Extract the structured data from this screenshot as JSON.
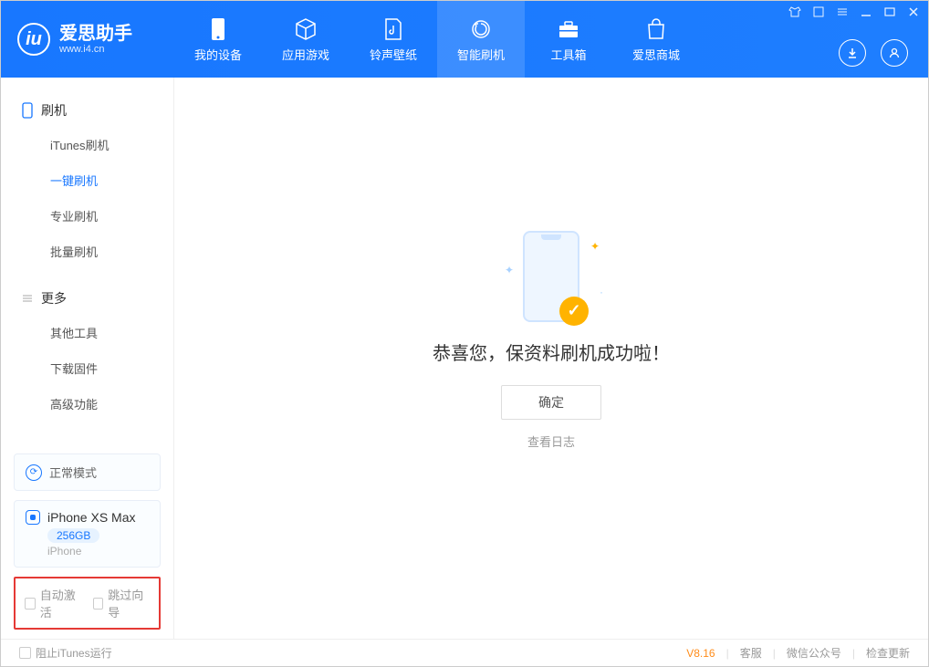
{
  "app": {
    "title": "爱思助手",
    "subtitle": "www.i4.cn"
  },
  "nav": {
    "items": [
      {
        "label": "我的设备"
      },
      {
        "label": "应用游戏"
      },
      {
        "label": "铃声壁纸"
      },
      {
        "label": "智能刷机"
      },
      {
        "label": "工具箱"
      },
      {
        "label": "爱思商城"
      }
    ]
  },
  "sidebar": {
    "group1_title": "刷机",
    "group1_items": [
      {
        "label": "iTunes刷机"
      },
      {
        "label": "一键刷机"
      },
      {
        "label": "专业刷机"
      },
      {
        "label": "批量刷机"
      }
    ],
    "group2_title": "更多",
    "group2_items": [
      {
        "label": "其他工具"
      },
      {
        "label": "下载固件"
      },
      {
        "label": "高级功能"
      }
    ],
    "mode_label": "正常模式",
    "device": {
      "name": "iPhone XS Max",
      "storage": "256GB",
      "type": "iPhone"
    },
    "checkboxes": {
      "auto_activate": "自动激活",
      "skip_guide": "跳过向导"
    }
  },
  "main": {
    "success_text": "恭喜您，保资料刷机成功啦！",
    "confirm_label": "确定",
    "view_log_label": "查看日志"
  },
  "footer": {
    "block_itunes": "阻止iTunes运行",
    "version": "V8.16",
    "links": {
      "kefu": "客服",
      "wechat": "微信公众号",
      "update": "检查更新"
    }
  }
}
